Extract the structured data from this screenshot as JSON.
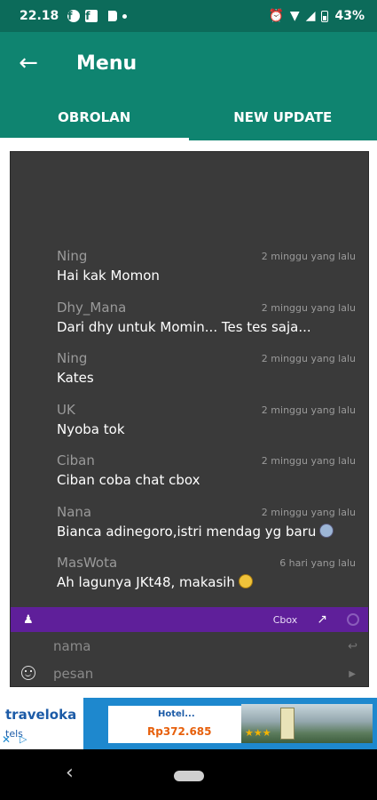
{
  "status": {
    "time": "22.18",
    "battery": "43%"
  },
  "app_bar": {
    "title": "Menu"
  },
  "tabs": [
    {
      "label": "OBROLAN"
    },
    {
      "label": "NEW UPDATE"
    }
  ],
  "chat": {
    "messages": [
      {
        "name": "Ning",
        "time": "2 minggu yang lalu",
        "text": "Hai kak Momon"
      },
      {
        "name": "Dhy_Mana",
        "time": "2 minggu yang lalu",
        "text": "Dari dhy untuk Momin... Tes tes saja..."
      },
      {
        "name": "Ning",
        "time": "2 minggu yang lalu",
        "text": "Kates"
      },
      {
        "name": "UK",
        "time": "2 minggu yang lalu",
        "text": "Nyoba tok"
      },
      {
        "name": "Ciban",
        "time": "2 minggu yang lalu",
        "text": "Ciban coba chat cbox"
      },
      {
        "name": "Nana",
        "time": "2 minggu yang lalu",
        "text": "Bianca adinegoro,istri mendag yg baru"
      },
      {
        "name": "MasWota",
        "time": "6 hari yang lalu",
        "text": "Ah lagunya JKt48, makasih"
      }
    ],
    "toolbar": {
      "label": "Cbox"
    },
    "name_placeholder": "nama",
    "message_placeholder": "pesan"
  },
  "ad": {
    "brand": "traveloka",
    "sub": "tels",
    "hotel_label": "Hotel...",
    "price": "Rp372.685"
  }
}
